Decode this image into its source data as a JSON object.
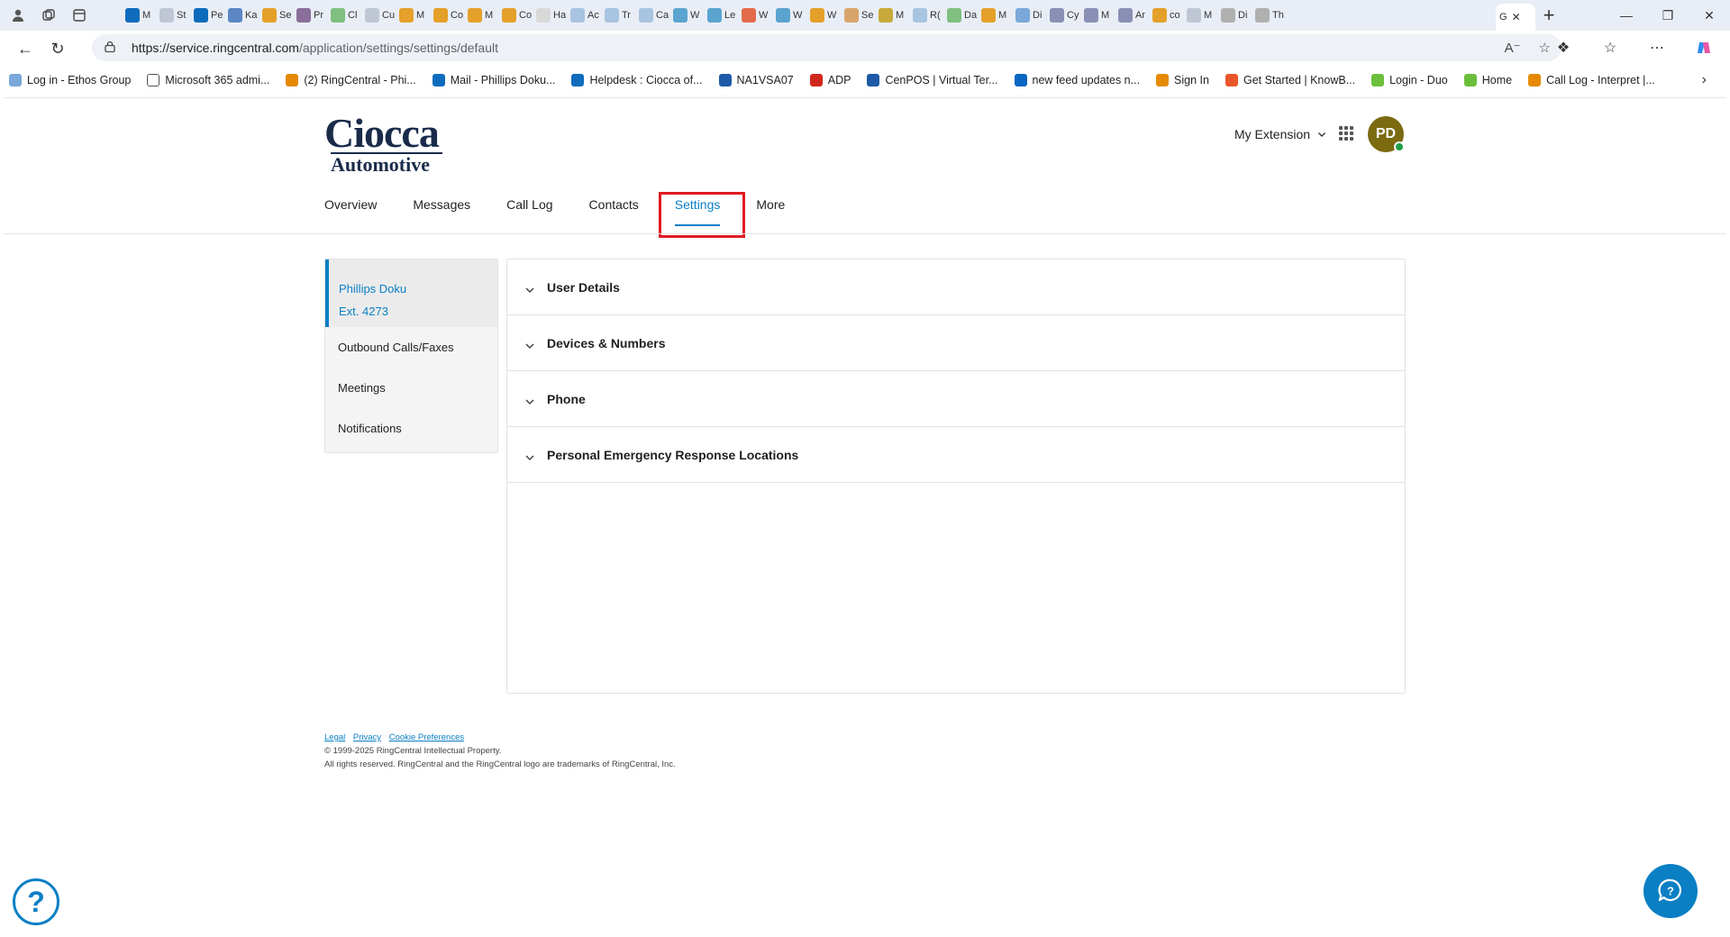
{
  "browser": {
    "tabs": [
      {
        "label": "M",
        "color": "#0f6cbd"
      },
      {
        "label": "St",
        "color": "#c0c7d4"
      },
      {
        "label": "Pe",
        "color": "#0f6cbd"
      },
      {
        "label": "Ka",
        "color": "#5b87c5"
      },
      {
        "label": "Se",
        "color": "#e5a02a"
      },
      {
        "label": "Pr",
        "color": "#8a6f9a"
      },
      {
        "label": "Cl",
        "color": "#7fbf7f"
      },
      {
        "label": "Cu",
        "color": "#c0c7d4"
      },
      {
        "label": "M",
        "color": "#e5a02a"
      },
      {
        "label": "Co",
        "color": "#e5a02a"
      },
      {
        "label": "M",
        "color": "#e5a02a"
      },
      {
        "label": "Co",
        "color": "#e5a02a"
      },
      {
        "label": "Ha",
        "color": "#d9d9d9"
      },
      {
        "label": "Ac",
        "color": "#a8c4e0"
      },
      {
        "label": "Tr",
        "color": "#a8c4e0"
      },
      {
        "label": "Ca",
        "color": "#a8c4e0"
      },
      {
        "label": "W",
        "color": "#5ba4cf"
      },
      {
        "label": "Le",
        "color": "#5ba4cf"
      },
      {
        "label": "W",
        "color": "#e36b4b"
      },
      {
        "label": "W",
        "color": "#5ba4cf"
      },
      {
        "label": "W",
        "color": "#e5a02a"
      },
      {
        "label": "Se",
        "color": "#d9a46b"
      },
      {
        "label": "M",
        "color": "#c9a93b"
      },
      {
        "label": "R(",
        "color": "#a8c4e0"
      },
      {
        "label": "Da",
        "color": "#7fbf7f"
      },
      {
        "label": "M",
        "color": "#e5a02a"
      },
      {
        "label": "Di",
        "color": "#7aa8d8"
      },
      {
        "label": "Cy",
        "color": "#8a8fb5"
      },
      {
        "label": "M",
        "color": "#8a8fb5"
      },
      {
        "label": "Ar",
        "color": "#8a8fb5"
      },
      {
        "label": "co",
        "color": "#e5a02a"
      },
      {
        "label": "M",
        "color": "#c0c7d4"
      },
      {
        "label": "Di",
        "color": "#b0b0b0"
      },
      {
        "label": "Th",
        "color": "#b0b0b0"
      }
    ],
    "active_tab": {
      "label": "G",
      "close": "✕"
    },
    "url_host": "https://service.ringcentral.com",
    "url_path": "/application/settings/settings/default",
    "bookmarks": [
      {
        "label": "Log in - Ethos Group",
        "color": "#7aa8d8"
      },
      {
        "label": "Microsoft 365 admi...",
        "color": "#ffffff"
      },
      {
        "label": "(2) RingCentral - Phi...",
        "color": "#e58a00"
      },
      {
        "label": "Mail - Phillips Doku...",
        "color": "#0f6cbd"
      },
      {
        "label": "Helpdesk : Ciocca of...",
        "color": "#0f6cbd"
      },
      {
        "label": "NA1VSA07",
        "color": "#1e5aa8"
      },
      {
        "label": "ADP",
        "color": "#d0271d"
      },
      {
        "label": "CenPOS | Virtual Ter...",
        "color": "#1e5aa8"
      },
      {
        "label": "new feed updates n...",
        "color": "#0a66c2"
      },
      {
        "label": "Sign In",
        "color": "#e58a00"
      },
      {
        "label": "Get Started | KnowB...",
        "color": "#e8562a"
      },
      {
        "label": "Login - Duo",
        "color": "#6bbf3b"
      },
      {
        "label": "Home",
        "color": "#6bbf3b"
      },
      {
        "label": "Call Log - Interpret |...",
        "color": "#e58a00"
      }
    ]
  },
  "header": {
    "logo_line1": "Ciocca",
    "logo_line2": "Automotive",
    "ext_menu_label": "My Extension",
    "avatar_initials": "PD"
  },
  "nav": {
    "items": [
      "Overview",
      "Messages",
      "Call Log",
      "Contacts",
      "Settings",
      "More"
    ],
    "active": "Settings"
  },
  "sidebar": {
    "user_name": "Phillips Doku",
    "user_ext": "Ext. 4273",
    "items": [
      "Outbound Calls/Faxes",
      "Meetings",
      "Notifications"
    ]
  },
  "panel": {
    "sections": [
      "User Details",
      "Devices & Numbers",
      "Phone",
      "Personal Emergency Response Locations"
    ]
  },
  "footer": {
    "links": [
      "Legal",
      "Privacy",
      "Cookie Preferences"
    ],
    "copyright": "© 1999-2025 RingCentral Intellectual Property.",
    "rights": "All rights reserved. RingCentral and the RingCentral logo are trademarks of RingCentral, Inc."
  },
  "colors": {
    "accent": "#0a7fc4",
    "highlight": "#e01a22",
    "avatar_bg": "#7b6a10",
    "presence": "#1e9e48"
  }
}
